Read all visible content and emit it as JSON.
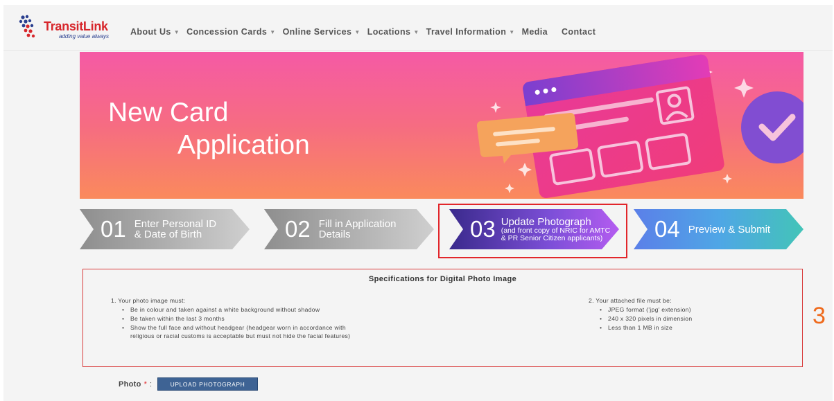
{
  "header": {
    "logo_name": "TransitLink",
    "logo_tagline": "adding value always",
    "nav": [
      {
        "label": "About Us",
        "dropdown": true
      },
      {
        "label": "Concession Cards",
        "dropdown": true
      },
      {
        "label": "Online Services",
        "dropdown": true
      },
      {
        "label": "Locations",
        "dropdown": true
      },
      {
        "label": "Travel Information",
        "dropdown": true
      },
      {
        "label": "Media",
        "dropdown": false
      },
      {
        "label": "Contact",
        "dropdown": false
      }
    ]
  },
  "banner": {
    "title_line1": "New Card",
    "title_line2": "Application"
  },
  "steps": [
    {
      "num": "01",
      "line1": "Enter Personal ID",
      "line2": "& Date of Birth",
      "active": false
    },
    {
      "num": "02",
      "line1": "Fill in Application",
      "line2": "Details",
      "active": false
    },
    {
      "num": "03",
      "line1": "Update Photograph",
      "sub1": "(and front copy of NRIC for AMTC",
      "sub2": "& PR Senior Citizen applicants)",
      "active": true
    },
    {
      "num": "04",
      "line1": "Preview & Submit",
      "active": false
    }
  ],
  "spec": {
    "title": "Specifications for Digital Photo Image",
    "col1_head": "1. Your photo image must:",
    "col1_items": [
      "Be in colour and taken against a white background without shadow",
      "Be taken within the last 3 months",
      "Show the full face and without headgear (headgear worn in accordance with",
      "religious or racial customs is acceptable but must not hide the facial features)"
    ],
    "col2_head": "2. Your attached file must be:",
    "col2_items": [
      "JPEG format ('jpg' extension)",
      "240 x 320 pixels in dimension",
      "Less than 1 MB in size"
    ]
  },
  "annotation": "3",
  "photo": {
    "label": "Photo",
    "required_mark": "*",
    "colon": ":",
    "button": "UPLOAD PHOTOGRAPH"
  },
  "colors": {
    "brand_red": "#d7262b",
    "highlight_red": "#e2262b",
    "button_blue": "#3e6394",
    "annotation_orange": "#ef6a1c"
  }
}
